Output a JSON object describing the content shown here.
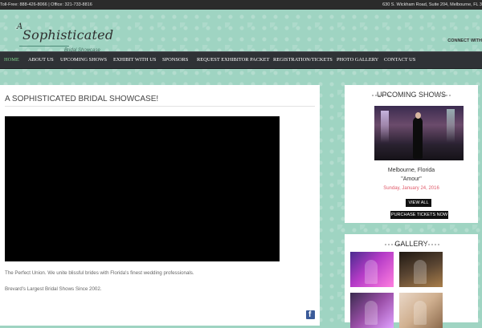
{
  "topbar": {
    "contact": "Toll-Free: 888-426-8066 | Office: 321-733-8816",
    "address": "630 S. Wickham Road, Suite 204, Melbourne, FL 3"
  },
  "logo": {
    "a": "A",
    "script": "Sophisticated",
    "sub": "Bridal Showcase"
  },
  "header": {
    "connect": "CONNECT WITH"
  },
  "nav": {
    "items": [
      {
        "label": "HOME",
        "active": true
      },
      {
        "label": "ABOUT US"
      },
      {
        "label": "UPCOMING SHOWS"
      },
      {
        "label": "EXHIBIT WITH US"
      },
      {
        "label": "SPONSORS"
      },
      {
        "label": "REQUEST EXHIBITOR PACKET"
      },
      {
        "label": "REGISTRATION/TICKETS"
      },
      {
        "label": "PHOTO GALLERY"
      },
      {
        "label": "CONTACT US"
      }
    ]
  },
  "main": {
    "title": "A SOPHISTICATED BRIDAL SHOWCASE!",
    "p1": "The Perfect Union. We unite blissful brides with Florida's finest wedding professionals.",
    "p2": "Brevard's Largest Bridal Shows Since 2002."
  },
  "sidebar": {
    "upcoming": {
      "title": "UPCOMING SHOWS",
      "location": "Melbourne, Florida",
      "name": "\"Amour\"",
      "date": "Sunday, January 24, 2016",
      "view_all": "VIEW ALL",
      "purchase": "PURCHASE TICKETS NOW"
    },
    "gallery": {
      "title": "GALLERY"
    }
  },
  "colors": {
    "background": "#9fd4c2",
    "topbar": "#2b2b2b",
    "nav": "#2f3236",
    "nav_active": "#7fd08a",
    "date": "#e05a6a",
    "facebook": "#3b5b99"
  },
  "icons": {
    "social": "facebook-icon"
  }
}
